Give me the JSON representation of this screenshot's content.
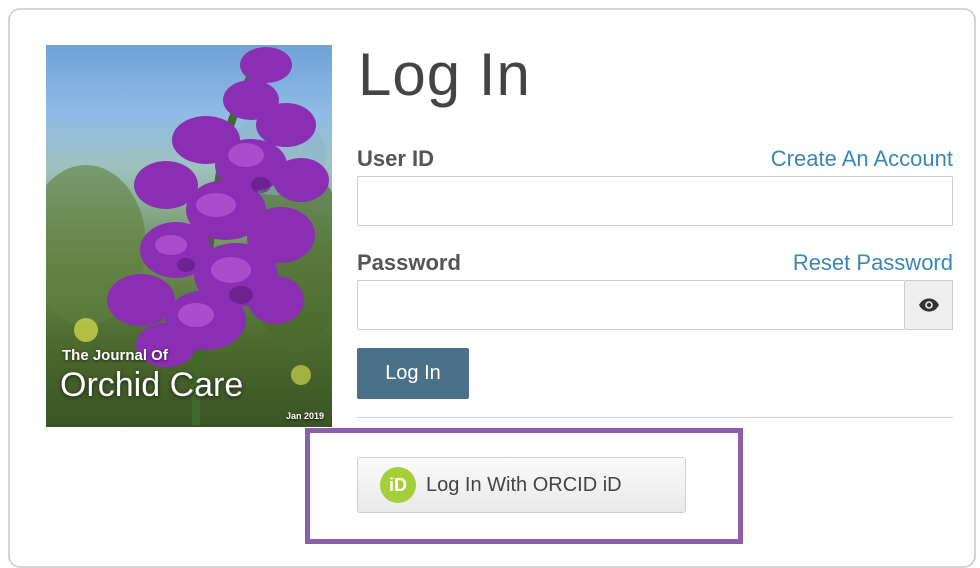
{
  "cover": {
    "line1": "The Journal Of",
    "line2": "Orchid Care",
    "date": "Jan 2019"
  },
  "form": {
    "title": "Log In",
    "user_id_label": "User ID",
    "create_account_link": "Create An Account",
    "password_label": "Password",
    "reset_password_link": "Reset Password",
    "user_id_value": "",
    "password_value": "",
    "login_button": "Log In",
    "show_password_icon": "eye-icon"
  },
  "orcid": {
    "logo_text": "iD",
    "button_label": "Log In With ORCID iD",
    "logo_color": "#a6ce39",
    "highlight_color": "#8d5faa"
  }
}
